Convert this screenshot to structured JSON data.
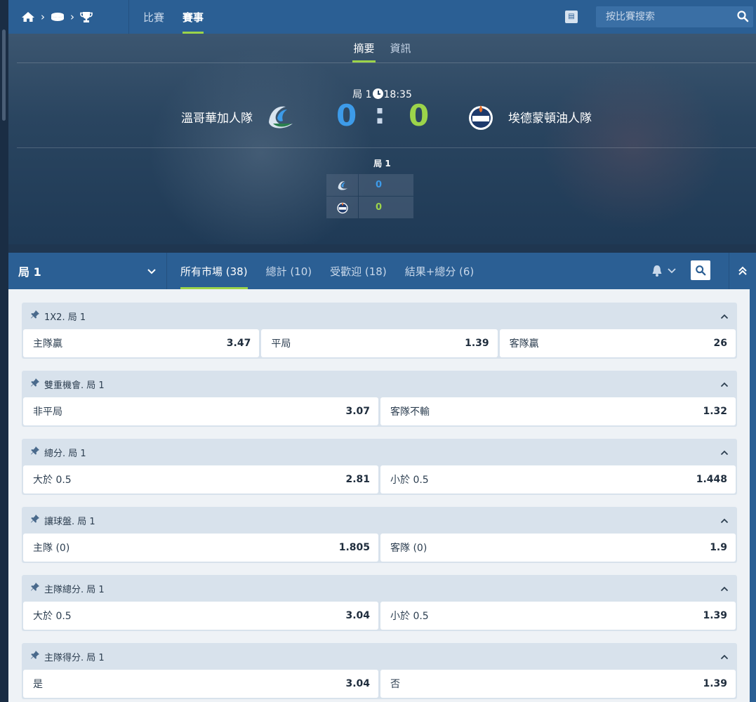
{
  "topnav": {
    "tabs": [
      {
        "label": "比賽"
      },
      {
        "label": "賽事"
      }
    ],
    "search_placeholder": "按比賽搜索"
  },
  "hero": {
    "tabs": [
      {
        "label": "摘要"
      },
      {
        "label": "資訊"
      }
    ],
    "period": "局 1",
    "time": "18:35",
    "home_team": "溫哥華加人隊",
    "away_team": "埃德蒙頓油人隊",
    "home_score": "0",
    "away_score": "0",
    "colon": ":",
    "period_label": "局 1",
    "period_scores": {
      "home": "0",
      "away": "0"
    },
    "colors": {
      "home": "#3d9be9",
      "away": "#9cd44a"
    }
  },
  "market_bar": {
    "period_select": "局 1",
    "tabs": [
      {
        "label": "所有市場 (38)"
      },
      {
        "label": "總計 (10)"
      },
      {
        "label": "受歡迎 (18)"
      },
      {
        "label": "結果+總分 (6)"
      }
    ]
  },
  "markets": [
    {
      "title": "1X2. 局 1",
      "selections": [
        {
          "label": "主隊贏",
          "odd": "3.47"
        },
        {
          "label": "平局",
          "odd": "1.39"
        },
        {
          "label": "客隊贏",
          "odd": "26"
        }
      ]
    },
    {
      "title": "雙重機會. 局 1",
      "selections": [
        {
          "label": "非平局",
          "odd": "3.07"
        },
        {
          "label": "客隊不輸",
          "odd": "1.32"
        }
      ]
    },
    {
      "title": "總分. 局 1",
      "selections": [
        {
          "label": "大於 0.5",
          "odd": "2.81"
        },
        {
          "label": "小於 0.5",
          "odd": "1.448"
        }
      ]
    },
    {
      "title": "讓球盤. 局 1",
      "selections": [
        {
          "label": "主隊 (0)",
          "odd": "1.805"
        },
        {
          "label": "客隊 (0)",
          "odd": "1.9"
        }
      ]
    },
    {
      "title": "主隊總分. 局 1",
      "selections": [
        {
          "label": "大於 0.5",
          "odd": "3.04"
        },
        {
          "label": "小於 0.5",
          "odd": "1.39"
        }
      ]
    },
    {
      "title": "主隊得分. 局 1",
      "selections": [
        {
          "label": "是",
          "odd": "3.04"
        },
        {
          "label": "否",
          "odd": "1.39"
        }
      ]
    }
  ]
}
